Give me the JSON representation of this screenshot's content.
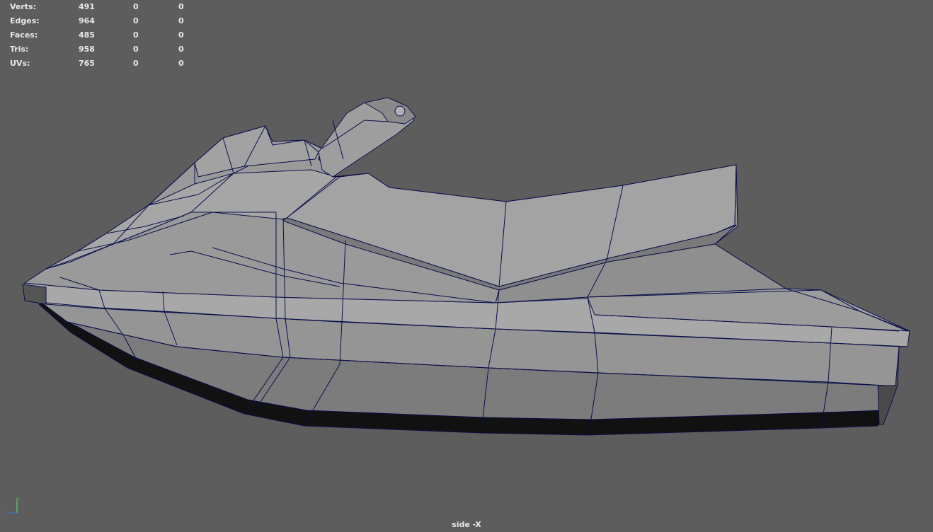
{
  "hud": {
    "rows": [
      {
        "label": "Verts:",
        "c1": "491",
        "c2": "0",
        "c3": "0"
      },
      {
        "label": "Edges:",
        "c1": "964",
        "c2": "0",
        "c3": "0"
      },
      {
        "label": "Faces:",
        "c1": "485",
        "c2": "0",
        "c3": "0"
      },
      {
        "label": "Tris:",
        "c1": "958",
        "c2": "0",
        "c3": "0"
      },
      {
        "label": "UVs:",
        "c1": "765",
        "c2": "0",
        "c3": "0"
      }
    ]
  },
  "camera": {
    "label": "side -X"
  },
  "axis": {
    "y": "y",
    "z": "z"
  },
  "colors": {
    "viewport_bg": "#5d5d5d",
    "wire": "#0a0f4a",
    "face_light": "#a3a3a3",
    "face_mid": "#8e8e8e",
    "face_dark": "#6f6f6f",
    "face_shadow": "#111111",
    "axis_y": "#4fd36a",
    "axis_z": "#3a78d8"
  }
}
